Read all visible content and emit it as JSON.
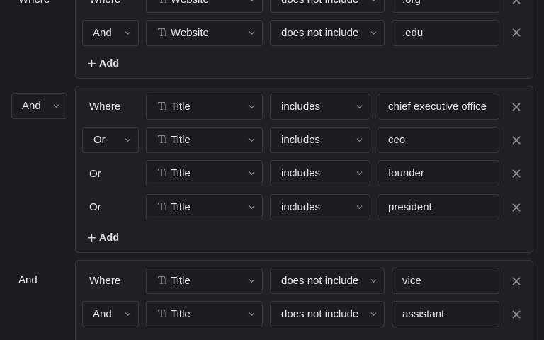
{
  "group1": {
    "rows": [
      {
        "conjunction": "Where",
        "field": "Website",
        "operator": "does not include",
        "value": ".org"
      },
      {
        "conjunction": "And",
        "field": "Website",
        "operator": "does not include",
        "value": ".edu"
      }
    ],
    "add_label": "Add"
  },
  "group2": {
    "group_conjunction": "And",
    "rows": [
      {
        "conjunction": "Where",
        "field": "Title",
        "operator": "includes",
        "value": "chief executive office"
      },
      {
        "conjunction": "Or",
        "field": "Title",
        "operator": "includes",
        "value": "ceo"
      },
      {
        "conjunction": "Or",
        "field": "Title",
        "operator": "includes",
        "value": "founder"
      },
      {
        "conjunction": "Or",
        "field": "Title",
        "operator": "includes",
        "value": "president"
      }
    ],
    "add_label": "Add"
  },
  "group3": {
    "group_conjunction": "And",
    "rows": [
      {
        "conjunction": "Where",
        "field": "Title",
        "operator": "does not include",
        "value": "vice"
      },
      {
        "conjunction": "And",
        "field": "Title",
        "operator": "does not include",
        "value": "assistant"
      }
    ]
  },
  "icons": {
    "field_type": "text-type-icon",
    "dropdown": "chevron-down-icon",
    "remove": "close-icon",
    "add": "plus-icon"
  },
  "colors": {
    "background": "#1c1d22",
    "border": "#36383f",
    "text": "#e9e9ee",
    "muted_icon": "#8e9098"
  }
}
